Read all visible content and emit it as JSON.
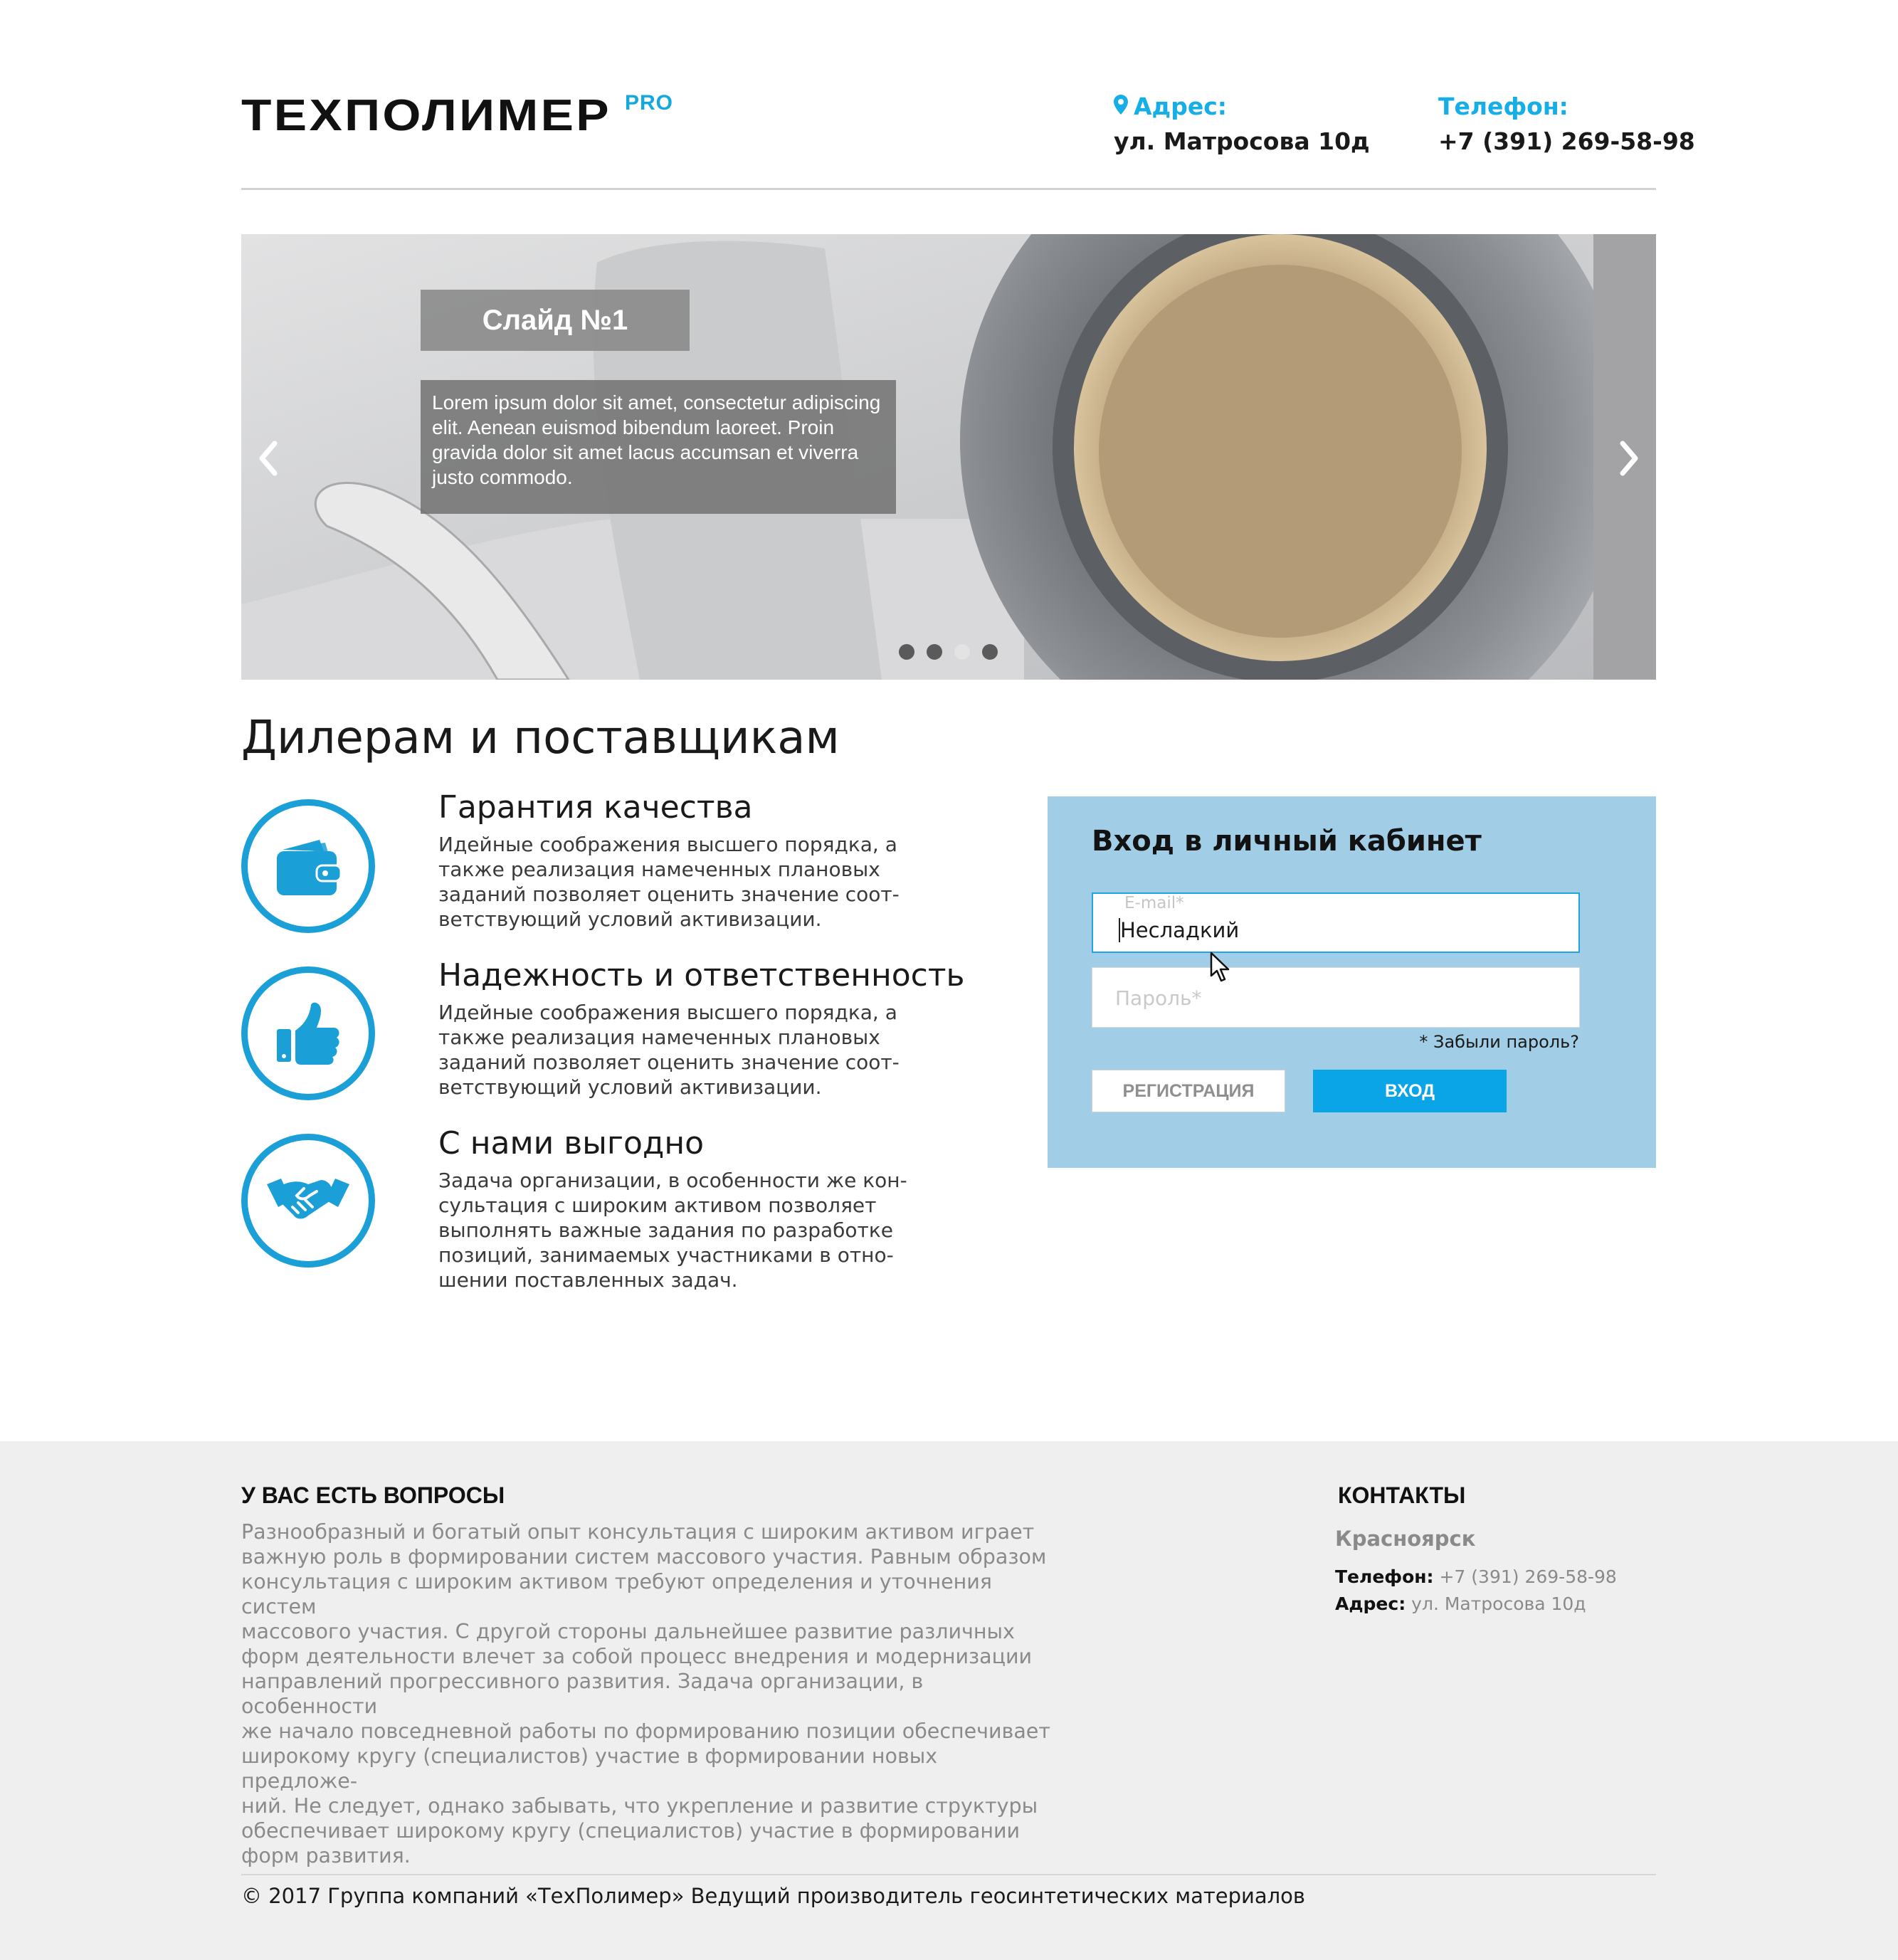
{
  "header": {
    "logo": "ТЕХПОЛИМЕР",
    "logo_suffix": "PRO",
    "address_label": "Адрес:",
    "address_value": "ул. Матросова 10д",
    "phone_label": "Телефон:",
    "phone_value": "+7 (391) 269-58-98"
  },
  "slider": {
    "title": "Слайд №1",
    "text": "Lorem ipsum dolor sit amet, consectetur adipiscing elit. Aenean euismod bibendum laoreet. Proin gravida dolor sit amet lacus accumsan et viverra justo commodo.",
    "dots": 4,
    "active_dot": 3
  },
  "section": {
    "title": "Дилерам и поставщикам",
    "features": [
      {
        "title": "Гарантия качества",
        "text": "Идейные соображения высшего порядка, а\nтакже реализация намеченных плановых\nзаданий позволяет оценить значение соот-\nветствующий условий активизации.",
        "icon": "wallet-icon"
      },
      {
        "title": "Надежность и ответственность",
        "text": "Идейные соображения высшего порядка, а\nтакже реализация намеченных плановых\nзаданий позволяет оценить значение соот-\nветствующий условий активизации.",
        "icon": "thumbs-up-icon"
      },
      {
        "title": "С нами выгодно",
        "text": "Задача организации, в особенности же кон-\nсультация с широким активом позволяет\nвыполнять важные задания по разработке\nпозиций, занимаемых участниками в отно-\nшении поставленных задач.",
        "icon": "handshake-icon"
      }
    ]
  },
  "login": {
    "title": "Вход в личный кабинет",
    "email_label": "E-mail*",
    "email_value": "Несладкий",
    "password_placeholder": "Пароль*",
    "forgot": "* Забыли пароль?",
    "register_button": "РЕГИСТРАЦИЯ",
    "login_button": "ВХОД"
  },
  "footer": {
    "faq_title": "У ВАС ЕСТЬ ВОПРОСЫ",
    "faq_text": "Разнообразный и богатый опыт консультация с широким активом играет\nважную роль в формировании систем массового участия. Равным образом\nконсультация с широким активом требуют определения и уточнения систем\nмассового участия. С другой стороны дальнейшее развитие различных\nформ деятельности влечет за собой процесс внедрения и модернизации\nнаправлений прогрессивного развития. Задача организации, в особенности\nже начало повседневной работы по формированию позиции обеспечивает\nширокому кругу (специалистов) участие в формировании новых предложе-\nний. Не следует, однако забывать, что укрепление и развитие структуры\nобеспечивает широкому кругу (специалистов) участие в формировании\nформ развития.",
    "contacts_title": "КОНТАКТЫ",
    "city": "Красноярск",
    "phone_label": "Телефон:",
    "phone_value": "+7 (391) 269-58-98",
    "address_label": "Адрес:",
    "address_value": "ул. Матросова 10д",
    "copyright": "© 2017 Группа компаний «ТехПолимер» Ведущий производитель геосинтетических материалов"
  },
  "colors": {
    "accent": "#15aee6",
    "icon_blue": "#1a9fd6",
    "login_bg": "#a2cde6",
    "login_button": "#0aa5e6",
    "footer_bg": "#efefef"
  }
}
